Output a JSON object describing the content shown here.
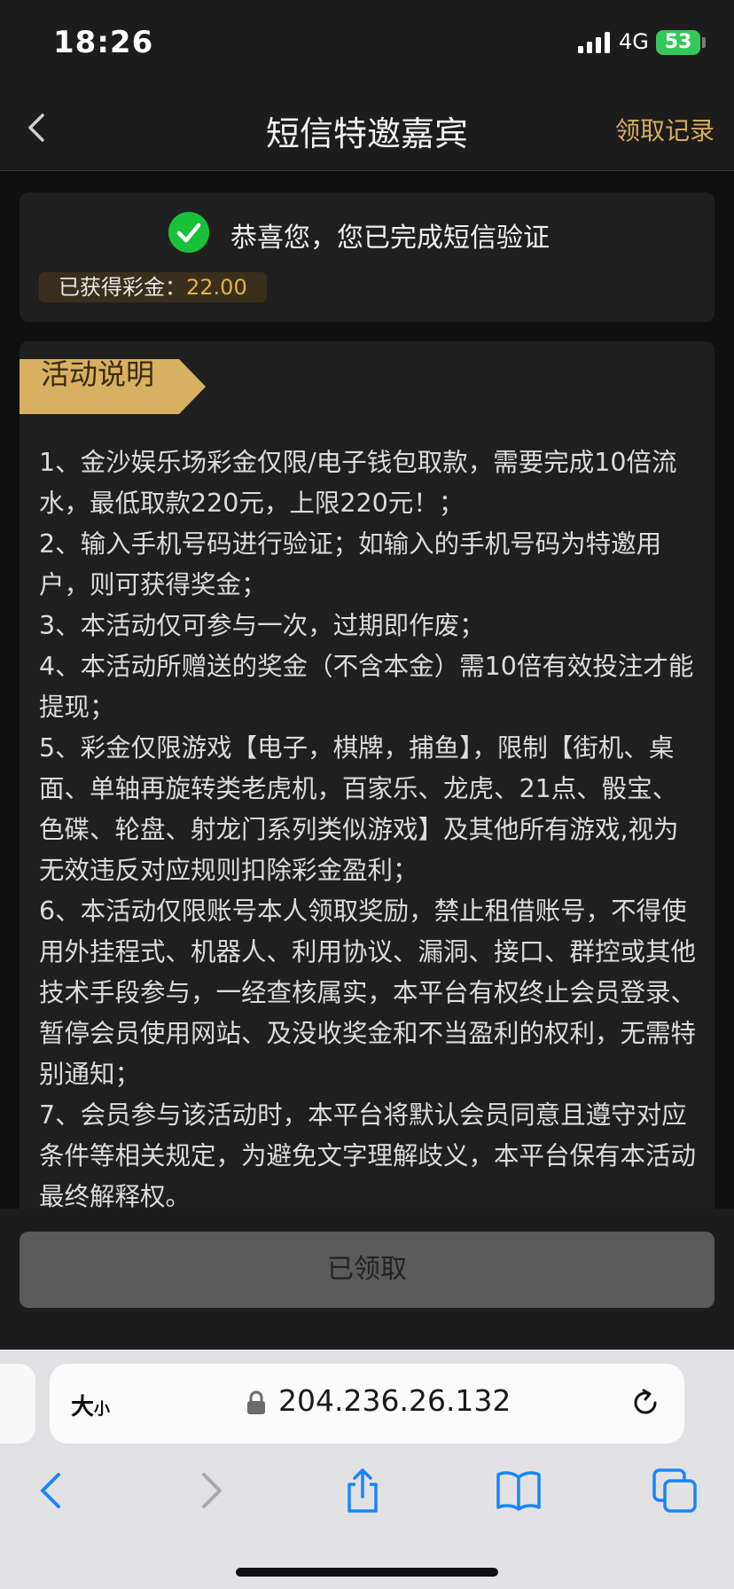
{
  "status_bar": {
    "time": "18:26",
    "network": "4G",
    "battery": "53"
  },
  "nav": {
    "title": "短信特邀嘉宾",
    "right_link": "领取记录"
  },
  "success": {
    "message": "恭喜您，您已完成短信验证",
    "bonus_label": "已获得彩金：",
    "bonus_amount": "22.00"
  },
  "rules": {
    "title": "活动说明",
    "items": [
      "1、金沙娱乐场彩金仅限/电子钱包取款，需要完成10倍流水，最低取款220元，上限220元！；",
      "2、输入手机号码进行验证；如输入的手机号码为特邀用户，则可获得奖金；",
      "3、本活动仅可参与一次，过期即作废；",
      "4、本活动所赠送的奖金（不含本金）需10倍有效投注才能提现；",
      "5、彩金仅限游戏【电子，棋牌，捕鱼】，限制【街机、桌面、单轴再旋转类老虎机，百家乐、龙虎、21点、骰宝、色碟、轮盘、射龙门系列类似游戏】及其他所有游戏,视为无效违反对应规则扣除彩金盈利；",
      "6、本活动仅限账号本人领取奖励，禁止租借账号，不得使用外挂程式、机器人、利用协议、漏洞、接口、群控或其他技术手段参与，一经查核属实，本平台有权终止会员登录、暂停会员使用网站、及没收奖金和不当盈利的权利，无需特别通知；",
      "7、会员参与该活动时，本平台将默认会员同意且遵守对应条件等相关规定，为避免文字理解歧义，本平台保有本活动最终解释权。"
    ]
  },
  "action": {
    "button_label": "已领取"
  },
  "browser": {
    "text_size_big": "大",
    "text_size_small": "小",
    "url": "204.236.26.132"
  },
  "colors": {
    "accent_gold": "#d6ad5b",
    "success_green": "#19c13a",
    "safari_blue": "#1a84ff"
  }
}
